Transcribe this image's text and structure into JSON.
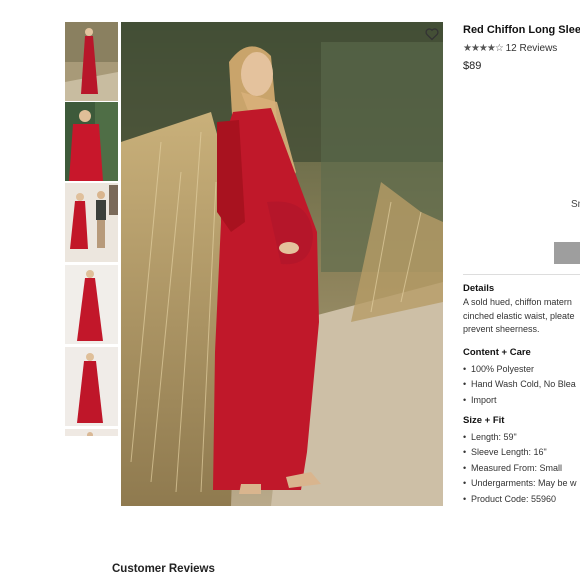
{
  "product": {
    "title": "Red Chiffon Long Sleeve",
    "stars_display": "★★★★☆",
    "review_count": "12 Reviews",
    "rating": 4,
    "price": "$89",
    "size_fragment": "Sm"
  },
  "details": {
    "heading": "Details",
    "lines": [
      "A sold hued, chiffon matern",
      "cinched elastic waist, pleate",
      "prevent sheerness."
    ]
  },
  "content_care": {
    "heading": "Content + Care",
    "items": [
      "100% Polyester",
      "Hand Wash Cold, No Blea",
      "Import"
    ]
  },
  "size_fit": {
    "heading": "Size + Fit",
    "items": [
      "Length: 59\"",
      "Sleeve Length: 16\"",
      "Measured From: Small",
      "Undergarments: May be w",
      "Product Code: 55960"
    ]
  },
  "reviews": {
    "heading": "Customer Reviews"
  },
  "colors": {
    "dress_red": "#c0182a",
    "button_gray": "#9e9e9e"
  },
  "icons": {
    "wishlist": "heart-icon"
  }
}
